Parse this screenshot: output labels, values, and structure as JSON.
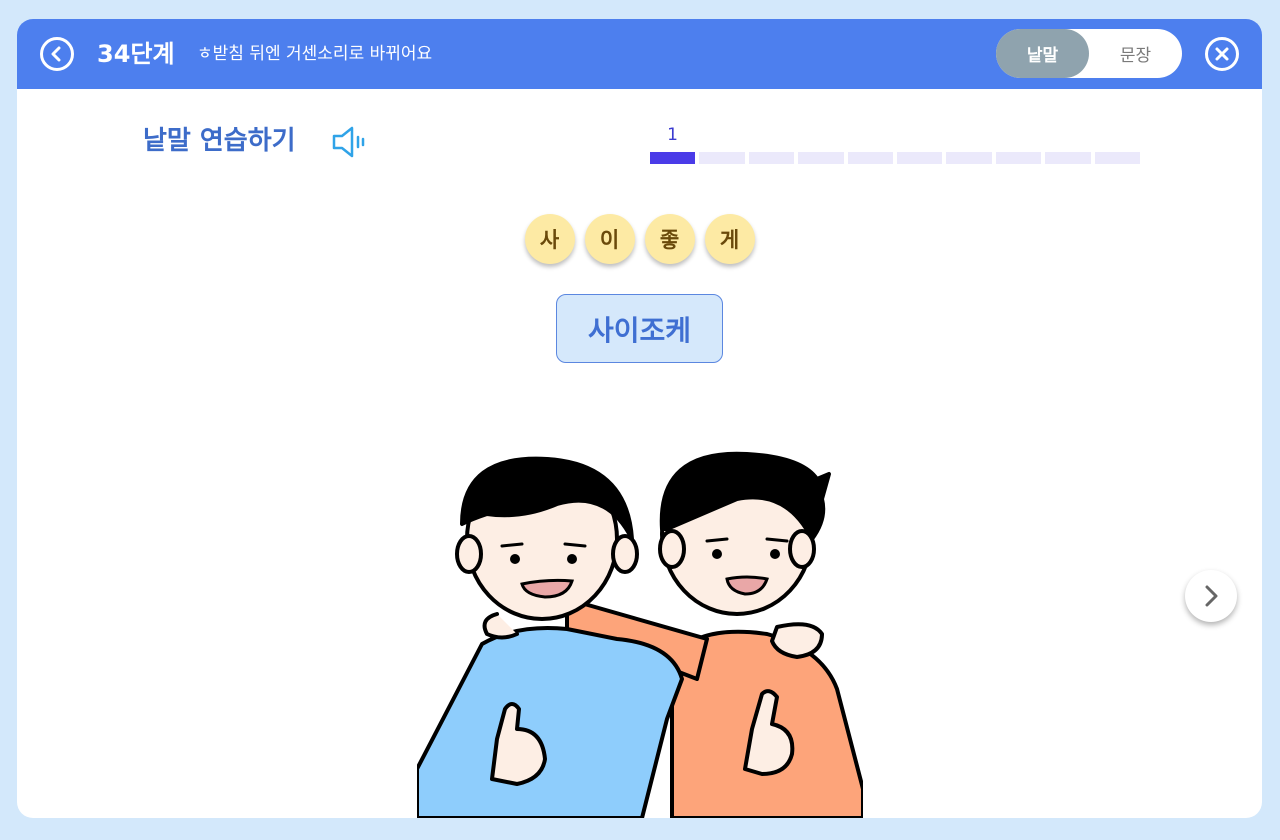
{
  "header": {
    "level": "34단계",
    "subtitle": "ㅎ받침 뒤엔 거센소리로 바뀌어요",
    "toggle": {
      "active": "낱말",
      "inactive": "문장"
    }
  },
  "practice": {
    "title": "낱말 연습하기",
    "progress_current": "1",
    "progress_total": 10
  },
  "syllables": [
    "사",
    "이",
    "좋",
    "게"
  ],
  "pronunciation": "사이조케",
  "colors": {
    "header": "#4d7fee",
    "background": "#d3e8fb",
    "progress_active": "#4a3be8",
    "progress_inactive": "#ebe9fb",
    "syllable_bg": "#fdeaa4",
    "pron_bg": "#d5e8fb"
  },
  "icons": [
    "back-arrow-icon",
    "close-icon",
    "speaker-icon",
    "chevron-right-icon"
  ]
}
